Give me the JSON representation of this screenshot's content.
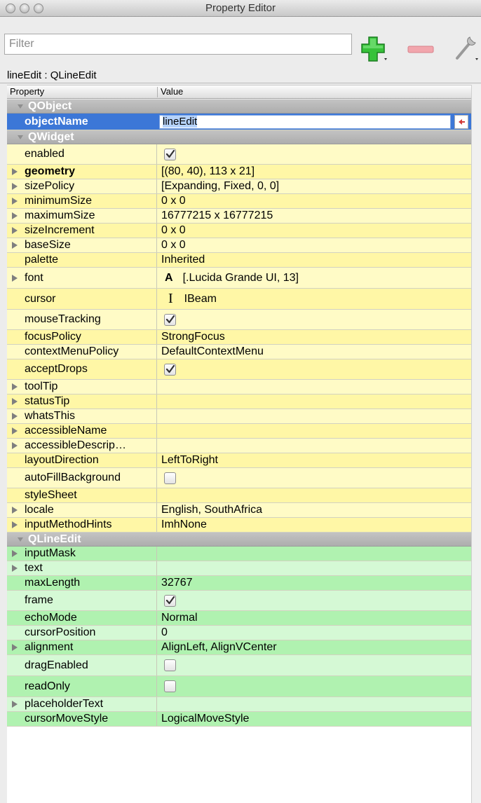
{
  "window": {
    "title": "Property Editor"
  },
  "toolbar": {
    "filter_placeholder": "Filter",
    "add_icon": "plus-icon",
    "remove_icon": "minus-icon",
    "config_icon": "wrench-icon"
  },
  "object_line": "lineEdit : QLineEdit",
  "table": {
    "col_property": "Property",
    "col_value": "Value",
    "rows": [
      {
        "kind": "group",
        "name": "QObject",
        "h": 20
      },
      {
        "kind": "edit",
        "name": "objectName",
        "value": "lineEdit",
        "h": 24
      },
      {
        "kind": "group",
        "name": "QWidget",
        "h": 20
      },
      {
        "kind": "prop",
        "name": "enabled",
        "value": "",
        "check": true,
        "color": "y1",
        "h": 29
      },
      {
        "kind": "prop",
        "name": "geometry",
        "value": "[(80, 40), 113 x 21]",
        "expand": true,
        "bold": true,
        "color": "y2",
        "h": 21
      },
      {
        "kind": "prop",
        "name": "sizePolicy",
        "value": "[Expanding, Fixed, 0, 0]",
        "expand": true,
        "color": "y1",
        "h": 21
      },
      {
        "kind": "prop",
        "name": "minimumSize",
        "value": "0 x 0",
        "expand": true,
        "color": "y2",
        "h": 21
      },
      {
        "kind": "prop",
        "name": "maximumSize",
        "value": "16777215 x 16777215",
        "expand": true,
        "color": "y1",
        "h": 21
      },
      {
        "kind": "prop",
        "name": "sizeIncrement",
        "value": "0 x 0",
        "expand": true,
        "color": "y2",
        "h": 21
      },
      {
        "kind": "prop",
        "name": "baseSize",
        "value": "0 x 0",
        "expand": true,
        "color": "y1",
        "h": 21
      },
      {
        "kind": "prop",
        "name": "palette",
        "value": "Inherited",
        "color": "y2",
        "h": 21
      },
      {
        "kind": "prop",
        "name": "font",
        "value": "[.Lucida Grande UI, 13]",
        "icon": "A",
        "expand": true,
        "color": "y1",
        "h": 30
      },
      {
        "kind": "prop",
        "name": "cursor",
        "value": "IBeam",
        "icon": "I",
        "color": "y2",
        "h": 30
      },
      {
        "kind": "prop",
        "name": "mouseTracking",
        "value": "",
        "check": true,
        "color": "y1",
        "h": 29
      },
      {
        "kind": "prop",
        "name": "focusPolicy",
        "value": "StrongFocus",
        "color": "y2",
        "h": 21
      },
      {
        "kind": "prop",
        "name": "contextMenuPolicy",
        "value": "DefaultContextMenu",
        "color": "y1",
        "h": 21
      },
      {
        "kind": "prop",
        "name": "acceptDrops",
        "value": "",
        "check": true,
        "color": "y2",
        "h": 29
      },
      {
        "kind": "prop",
        "name": "toolTip",
        "value": "",
        "expand": true,
        "color": "y1",
        "h": 21
      },
      {
        "kind": "prop",
        "name": "statusTip",
        "value": "",
        "expand": true,
        "color": "y2",
        "h": 21
      },
      {
        "kind": "prop",
        "name": "whatsThis",
        "value": "",
        "expand": true,
        "color": "y1",
        "h": 21
      },
      {
        "kind": "prop",
        "name": "accessibleName",
        "value": "",
        "expand": true,
        "color": "y2",
        "h": 21
      },
      {
        "kind": "prop",
        "name": "accessibleDescrip…",
        "value": "",
        "expand": true,
        "color": "y1",
        "h": 21
      },
      {
        "kind": "prop",
        "name": "layoutDirection",
        "value": "LeftToRight",
        "color": "y2",
        "h": 21
      },
      {
        "kind": "prop",
        "name": "autoFillBackground",
        "value": "",
        "check": false,
        "color": "y1",
        "h": 29
      },
      {
        "kind": "prop",
        "name": "styleSheet",
        "value": "",
        "color": "y2",
        "h": 21
      },
      {
        "kind": "prop",
        "name": "locale",
        "value": "English, SouthAfrica",
        "expand": true,
        "color": "y1",
        "h": 21
      },
      {
        "kind": "prop",
        "name": "inputMethodHints",
        "value": "ImhNone",
        "expand": true,
        "color": "y2",
        "h": 21
      },
      {
        "kind": "group",
        "name": "QLineEdit",
        "h": 20
      },
      {
        "kind": "prop",
        "name": "inputMask",
        "value": "",
        "expand": true,
        "color": "g2",
        "h": 21
      },
      {
        "kind": "prop",
        "name": "text",
        "value": "",
        "expand": true,
        "color": "g1",
        "h": 21
      },
      {
        "kind": "prop",
        "name": "maxLength",
        "value": "32767",
        "color": "g2",
        "h": 21
      },
      {
        "kind": "prop",
        "name": "frame",
        "value": "",
        "check": true,
        "color": "g1",
        "h": 29
      },
      {
        "kind": "prop",
        "name": "echoMode",
        "value": "Normal",
        "color": "g2",
        "h": 21
      },
      {
        "kind": "prop",
        "name": "cursorPosition",
        "value": "0",
        "color": "g1",
        "h": 21
      },
      {
        "kind": "prop",
        "name": "alignment",
        "value": "AlignLeft, AlignVCenter",
        "expand": true,
        "color": "g2",
        "h": 21
      },
      {
        "kind": "prop",
        "name": "dragEnabled",
        "value": "",
        "check": false,
        "color": "g1",
        "h": 30
      },
      {
        "kind": "prop",
        "name": "readOnly",
        "value": "",
        "check": false,
        "color": "g2",
        "h": 30
      },
      {
        "kind": "prop",
        "name": "placeholderText",
        "value": "",
        "expand": true,
        "color": "g1",
        "h": 21
      },
      {
        "kind": "prop",
        "name": "cursorMoveStyle",
        "value": "LogicalMoveStyle",
        "color": "g2",
        "h": 21
      }
    ]
  }
}
